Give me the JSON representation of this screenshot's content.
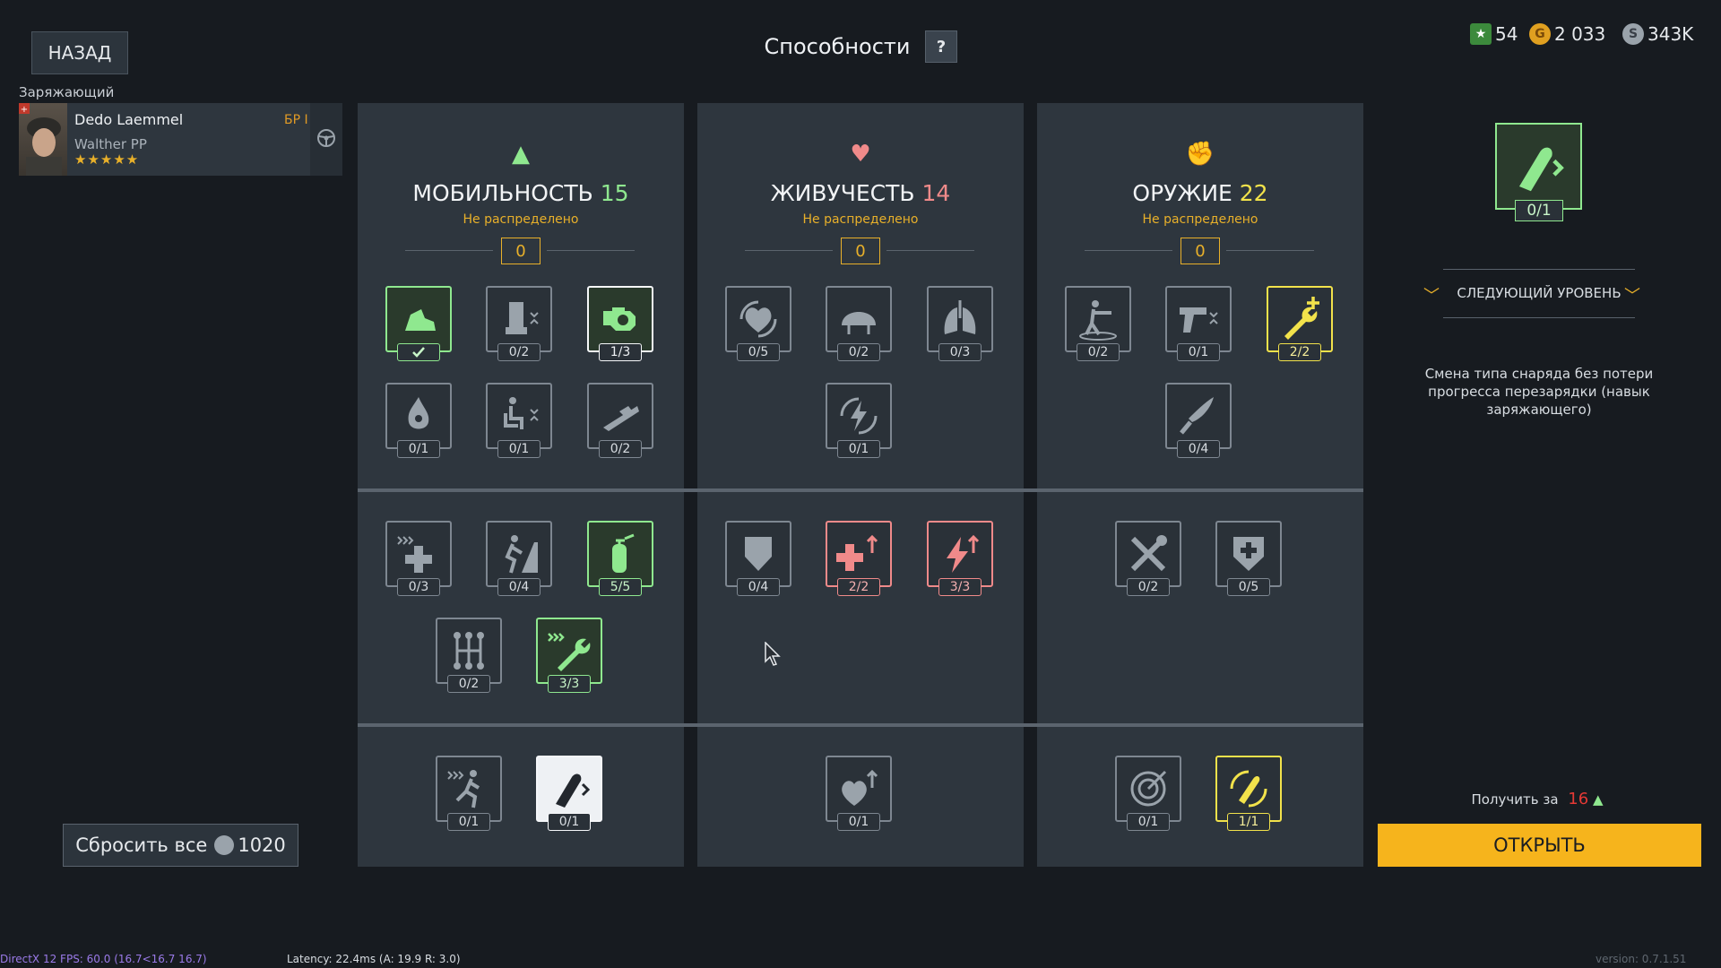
{
  "header": {
    "back_label": "НАЗАД",
    "title": "Способности",
    "help_label": "?"
  },
  "currencies": [
    {
      "name": "stars",
      "value": "54"
    },
    {
      "name": "gold",
      "value": "2 033"
    },
    {
      "name": "silver",
      "value": "343K"
    }
  ],
  "crew": {
    "role": "Заряжающий",
    "name": "Dedo Laemmel",
    "weapon": "Walther PP",
    "rank": "БР I",
    "stars": "★★★★★"
  },
  "panels": [
    {
      "title": "МОБИЛЬНОСТЬ",
      "points": "15",
      "points_color": "#8fe88f",
      "unassigned_label": "Не распределено",
      "unassigned_value": "0",
      "skills": [
        "",
        "0/2",
        "1/3",
        "0/1",
        "0/1",
        "0/2",
        "0/3",
        "0/4",
        "5/5",
        "0/2",
        "3/3",
        "0/1",
        "0/1"
      ]
    },
    {
      "title": "ЖИВУЧЕСТЬ",
      "points": "14",
      "points_color": "#f08a8a",
      "unassigned_label": "Не распределено",
      "unassigned_value": "0",
      "skills": [
        "0/5",
        "0/2",
        "0/3",
        "0/1",
        "0/4",
        "2/2",
        "3/3",
        "0/1"
      ]
    },
    {
      "title": "ОРУЖИЕ",
      "points": "22",
      "points_color": "#f2e24b",
      "unassigned_label": "Не распределено",
      "unassigned_value": "0",
      "skills": [
        "0/2",
        "0/1",
        "2/2",
        "0/4",
        "0/2",
        "0/5",
        "0/1",
        "1/1"
      ]
    }
  ],
  "right_panel": {
    "selected_count": "0/1",
    "next_level": "СЛЕДУЮЩИЙ УРОВЕНЬ",
    "description": "Смена типа снаряда без потери прогресса перезарядки (навык заряжающего)",
    "get_for_label": "Получить за",
    "get_for_value": "16",
    "open_label": "ОТКРЫТЬ"
  },
  "reset": {
    "label": "Сбросить все",
    "cost": "1020"
  },
  "debug": {
    "fps": "DirectX 12 FPS: 60.0 (16.7<16.7 16.7)",
    "latency": "Latency: 22.4ms (A: 19.9 R:  3.0)",
    "version": "version: 0.7.1.51"
  },
  "colors": {
    "mobility": "#8fe88f",
    "survival": "#f08a8a",
    "weapons": "#f2e24b",
    "accent": "#f6b41c"
  }
}
